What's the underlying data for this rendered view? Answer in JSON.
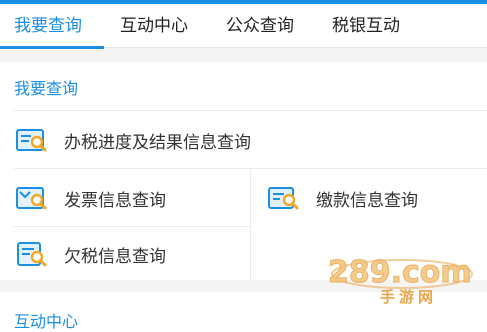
{
  "tabs": [
    {
      "label": "我要查询",
      "active": true
    },
    {
      "label": "互动中心",
      "active": false
    },
    {
      "label": "公众查询",
      "active": false
    },
    {
      "label": "税银互动",
      "active": false
    }
  ],
  "query_section": {
    "title": "我要查询",
    "items": [
      {
        "label": "办税进度及结果信息查询",
        "icon": "progress-search-icon"
      },
      {
        "label": "发票信息查询",
        "icon": "invoice-search-icon"
      },
      {
        "label": "缴款信息查询",
        "icon": "payment-search-icon"
      },
      {
        "label": "欠税信息查询",
        "icon": "arrears-search-icon"
      }
    ]
  },
  "interaction_section": {
    "title": "互动中心"
  },
  "watermark": {
    "logo_text": "289.com",
    "sub_text": "手游网"
  },
  "colors": {
    "accent": "#1a8fe3",
    "icon_orange": "#f5a623",
    "watermark": "#e9a64b"
  }
}
